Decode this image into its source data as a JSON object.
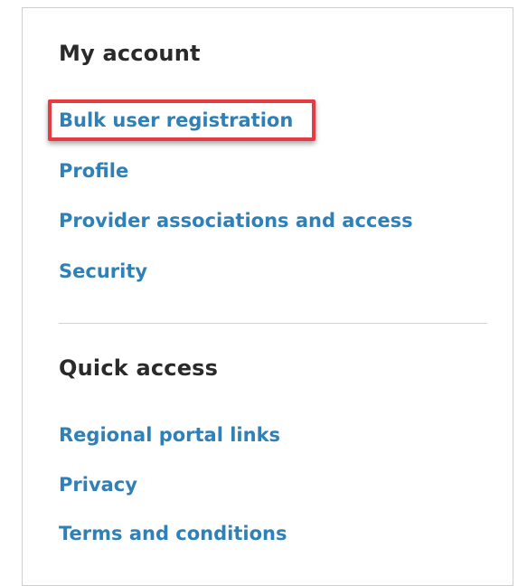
{
  "my_account": {
    "title": "My account",
    "links": [
      {
        "label": "Bulk user registration",
        "highlighted": true
      },
      {
        "label": "Profile"
      },
      {
        "label": "Provider associations and access"
      },
      {
        "label": "Security"
      }
    ]
  },
  "quick_access": {
    "title": "Quick access",
    "links": [
      {
        "label": "Regional portal links"
      },
      {
        "label": "Privacy"
      },
      {
        "label": "Terms and conditions"
      }
    ]
  },
  "colors": {
    "link": "#2f80b7",
    "heading": "#2a2a2a",
    "highlight": "#e53b43",
    "divider": "#d2d2d2",
    "panel_border": "#cfcfcf"
  }
}
